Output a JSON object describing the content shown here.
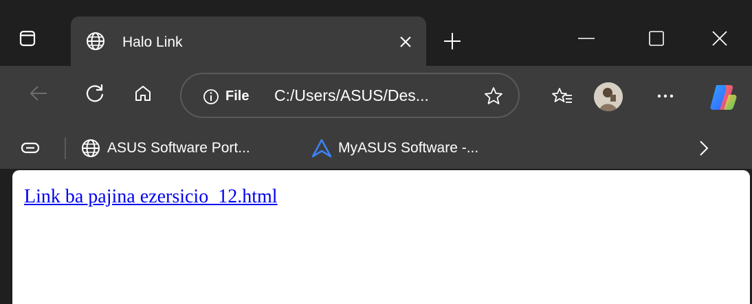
{
  "browser": {
    "tab": {
      "title": "Halo Link",
      "favicon": "globe-icon"
    },
    "address_bar": {
      "scheme_label": "File",
      "url": "C:/Users/ASUS/Des..."
    },
    "bookmarks": [
      {
        "label": "ASUS Software Port...",
        "icon": "globe-icon"
      },
      {
        "label": "MyASUS Software -...",
        "icon": "myasus-logo-icon"
      }
    ]
  },
  "page": {
    "link_text": "Link ba pajina ezersicio_12.html"
  },
  "colors": {
    "chrome_dark": "#1f1f1f",
    "chrome_toolbar": "#3c3c3c",
    "link_blue": "#0000ee",
    "content_bg": "#ffffff"
  }
}
